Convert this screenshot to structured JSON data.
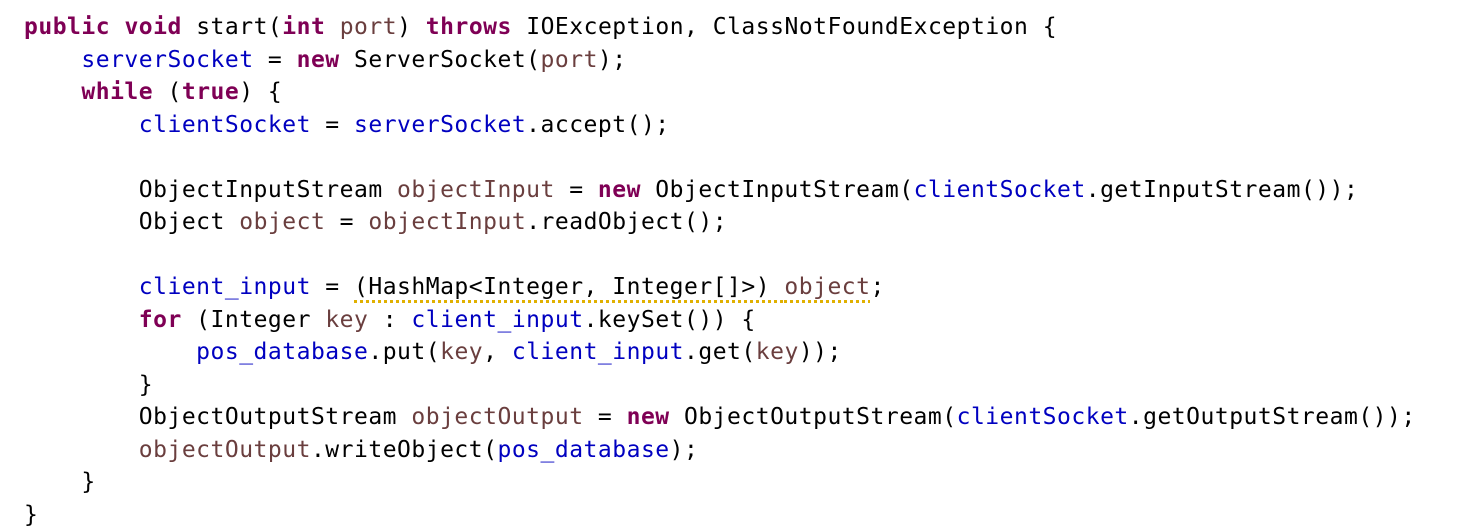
{
  "editor": {
    "language": "java",
    "colors": {
      "keyword": "#7f0055",
      "field": "#0000c0",
      "local": "#6a3e3e",
      "plain": "#000000",
      "warning_underline": "#e0b000"
    },
    "lines": [
      [
        {
          "t": "public",
          "k": "kw"
        },
        {
          "t": " ",
          "k": "plain"
        },
        {
          "t": "void",
          "k": "kw"
        },
        {
          "t": " start(",
          "k": "plain"
        },
        {
          "t": "int",
          "k": "kw"
        },
        {
          "t": " ",
          "k": "plain"
        },
        {
          "t": "port",
          "k": "local"
        },
        {
          "t": ") ",
          "k": "plain"
        },
        {
          "t": "throws",
          "k": "kw"
        },
        {
          "t": " IOException, ClassNotFoundException {",
          "k": "plain"
        }
      ],
      [
        {
          "t": "    ",
          "k": "plain"
        },
        {
          "t": "serverSocket",
          "k": "field"
        },
        {
          "t": " = ",
          "k": "plain"
        },
        {
          "t": "new",
          "k": "kw"
        },
        {
          "t": " ServerSocket(",
          "k": "plain"
        },
        {
          "t": "port",
          "k": "local"
        },
        {
          "t": ");",
          "k": "plain"
        }
      ],
      [
        {
          "t": "    ",
          "k": "plain"
        },
        {
          "t": "while",
          "k": "kw"
        },
        {
          "t": " (",
          "k": "plain"
        },
        {
          "t": "true",
          "k": "kw"
        },
        {
          "t": ") {",
          "k": "plain"
        }
      ],
      [
        {
          "t": "        ",
          "k": "plain"
        },
        {
          "t": "clientSocket",
          "k": "field"
        },
        {
          "t": " = ",
          "k": "plain"
        },
        {
          "t": "serverSocket",
          "k": "field"
        },
        {
          "t": ".accept();",
          "k": "plain"
        }
      ],
      [],
      [
        {
          "t": "        ObjectInputStream ",
          "k": "plain"
        },
        {
          "t": "objectInput",
          "k": "local"
        },
        {
          "t": " = ",
          "k": "plain"
        },
        {
          "t": "new",
          "k": "kw"
        },
        {
          "t": " ObjectInputStream(",
          "k": "plain"
        },
        {
          "t": "clientSocket",
          "k": "field"
        },
        {
          "t": ".getInputStream());",
          "k": "plain"
        }
      ],
      [
        {
          "t": "        Object ",
          "k": "plain"
        },
        {
          "t": "object",
          "k": "local"
        },
        {
          "t": " = ",
          "k": "plain"
        },
        {
          "t": "objectInput",
          "k": "local"
        },
        {
          "t": ".readObject();",
          "k": "plain"
        }
      ],
      [],
      [
        {
          "t": "        ",
          "k": "plain"
        },
        {
          "t": "client_input",
          "k": "field"
        },
        {
          "t": " = ",
          "k": "plain"
        },
        {
          "t": "(HashMap<Integer, Integer[]>) ",
          "k": "plain",
          "w": true
        },
        {
          "t": "object",
          "k": "local",
          "w": true
        },
        {
          "t": ";",
          "k": "plain"
        }
      ],
      [
        {
          "t": "        ",
          "k": "plain"
        },
        {
          "t": "for",
          "k": "kw"
        },
        {
          "t": " (Integer ",
          "k": "plain"
        },
        {
          "t": "key",
          "k": "local"
        },
        {
          "t": " : ",
          "k": "plain"
        },
        {
          "t": "client_input",
          "k": "field"
        },
        {
          "t": ".keySet()) {",
          "k": "plain"
        }
      ],
      [
        {
          "t": "            ",
          "k": "plain"
        },
        {
          "t": "pos_database",
          "k": "field"
        },
        {
          "t": ".put(",
          "k": "plain"
        },
        {
          "t": "key",
          "k": "local"
        },
        {
          "t": ", ",
          "k": "plain"
        },
        {
          "t": "client_input",
          "k": "field"
        },
        {
          "t": ".get(",
          "k": "plain"
        },
        {
          "t": "key",
          "k": "local"
        },
        {
          "t": "));",
          "k": "plain"
        }
      ],
      [
        {
          "t": "        }",
          "k": "plain"
        }
      ],
      [
        {
          "t": "        ObjectOutputStream ",
          "k": "plain"
        },
        {
          "t": "objectOutput",
          "k": "local"
        },
        {
          "t": " = ",
          "k": "plain"
        },
        {
          "t": "new",
          "k": "kw"
        },
        {
          "t": " ObjectOutputStream(",
          "k": "plain"
        },
        {
          "t": "clientSocket",
          "k": "field"
        },
        {
          "t": ".getOutputStream());",
          "k": "plain"
        }
      ],
      [
        {
          "t": "        ",
          "k": "plain"
        },
        {
          "t": "objectOutput",
          "k": "local"
        },
        {
          "t": ".writeObject(",
          "k": "plain"
        },
        {
          "t": "pos_database",
          "k": "field"
        },
        {
          "t": ");",
          "k": "plain"
        }
      ],
      [
        {
          "t": "    }",
          "k": "plain"
        }
      ],
      [
        {
          "t": "}",
          "k": "plain"
        }
      ]
    ]
  }
}
